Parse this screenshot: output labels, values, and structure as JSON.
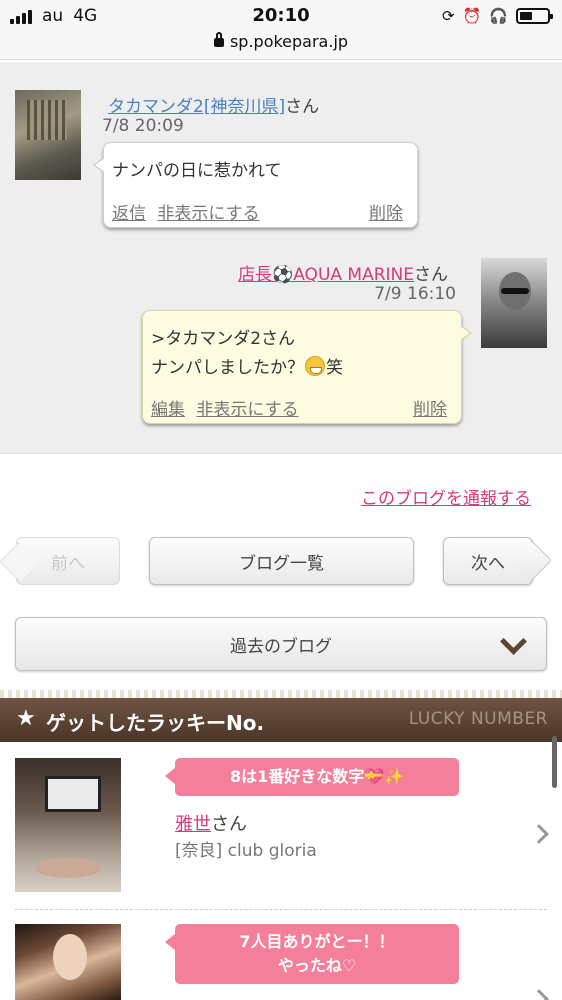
{
  "status": {
    "carrier": "au",
    "network": "4G",
    "time": "20:10",
    "url": "sp.pokepara.jp"
  },
  "comments": [
    {
      "name": "タカマンダ2[神奈川県]",
      "suffix": "さん",
      "date": "7/8 20:09",
      "lines": [
        "ナンパの日に惹かれて"
      ],
      "actions": {
        "reply": "返信",
        "hide": "非表示にする",
        "delete": "削除"
      }
    },
    {
      "name": "店長⚽AQUA MARINE",
      "suffix": "さん",
      "date": "7/9 16:10",
      "lines": [
        ">タカマンダ2さん",
        "ナンパしましたか？",
        "笑"
      ],
      "actions": {
        "edit": "編集",
        "hide": "非表示にする",
        "delete": "削除"
      }
    }
  ],
  "report_link": "このブログを通報する",
  "pager": {
    "prev": "前へ",
    "list": "ブログ一覧",
    "next": "次へ"
  },
  "past_blog": "過去のブログ",
  "lucky": {
    "title": "ゲットしたラッキーNo.",
    "title_en": "LUCKY NUMBER",
    "items": [
      {
        "message": "8は1番好きな数字",
        "name": "雅世",
        "suffix": "さん",
        "shop": "[奈良] club gloria"
      },
      {
        "message": "7人目ありがとー！！\nやったね♡"
      }
    ]
  },
  "colors": {
    "accent_pink": "#d43b7b",
    "link_blue": "#4a82bd",
    "tag_pink": "#f47f9a",
    "header_brown": "#5d4332"
  }
}
